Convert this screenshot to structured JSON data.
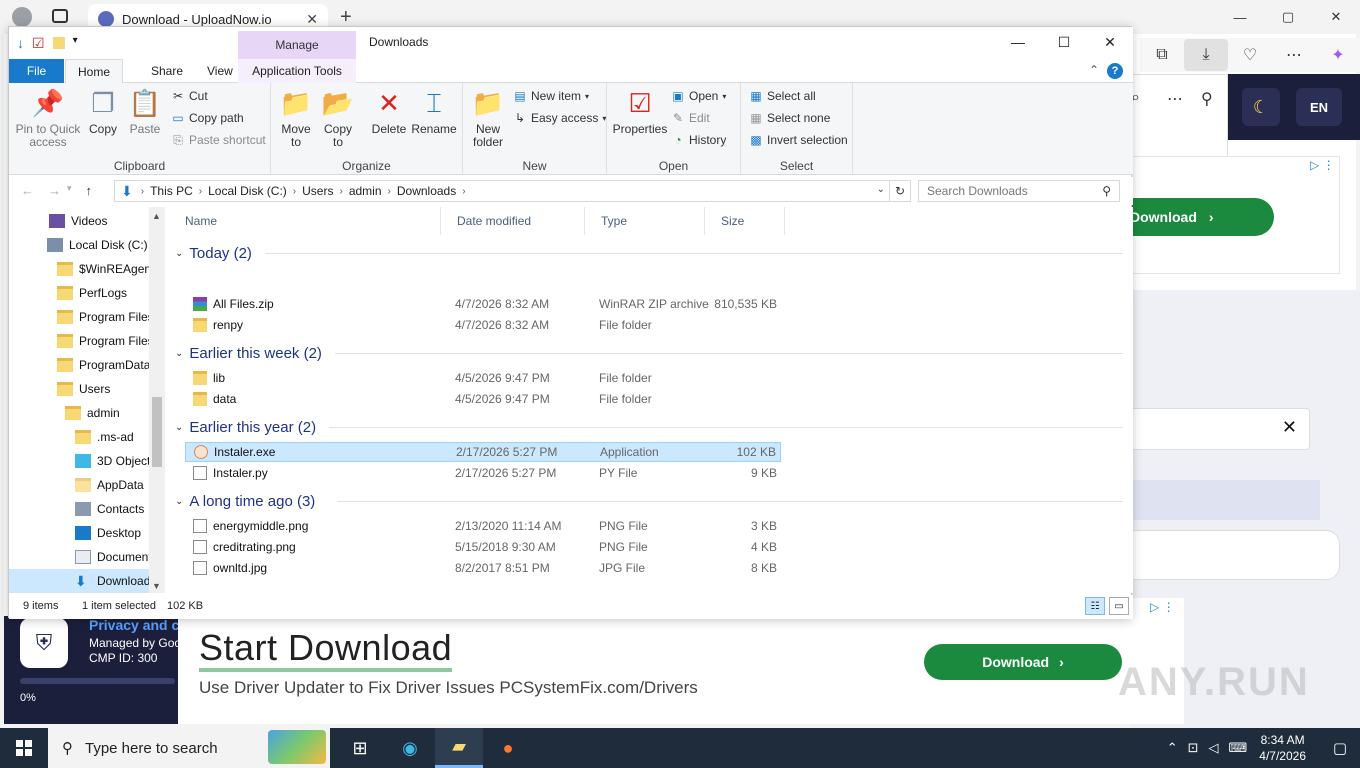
{
  "browser": {
    "tab_title": "Download - UploadNow.io",
    "tab_close": "✕",
    "new_tab": "+",
    "minimize": "—",
    "maximize": "▢",
    "close": "✕"
  },
  "site": {
    "theme_icon": "☾",
    "language": "EN",
    "right_ad_button": "Download",
    "right_ad_chevron": "›",
    "input_clear": "✕",
    "ad_choices": "▷ ⋮"
  },
  "cmp": {
    "title": "Privacy and c",
    "line1": "Managed by Goo",
    "line2": "CMP ID: 300",
    "progress_label": "0%",
    "progress_fraction": 0
  },
  "bottom_ad": {
    "title": "Start Download",
    "subtitle": "Use Driver Updater to Fix Driver Issues PCSystemFix.com/Drivers",
    "button": "Download",
    "chevron": "›",
    "ad_choices": "▷ ⋮",
    "watermark": "ANY.RUN"
  },
  "explorer": {
    "window_title": "Downloads",
    "manage_tab": "Manage",
    "minimize": "—",
    "maximize": "☐",
    "close": "✕",
    "ribbon_tabs": {
      "file": "File",
      "home": "Home",
      "share": "Share",
      "view": "View",
      "app_tools": "Application Tools"
    },
    "help": "?",
    "collapse": "⌃",
    "ribbon": {
      "clipboard": {
        "label": "Clipboard",
        "pin": "Pin to Quick access",
        "copy": "Copy",
        "paste": "Paste",
        "cut": "Cut",
        "copy_path": "Copy path",
        "paste_shortcut": "Paste shortcut"
      },
      "organize": {
        "label": "Organize",
        "move_to": "Move to",
        "copy_to": "Copy to",
        "delete": "Delete",
        "rename": "Rename"
      },
      "new": {
        "label": "New",
        "new_folder": "New folder",
        "new_item": "New item",
        "easy_access": "Easy access"
      },
      "open": {
        "label": "Open",
        "properties": "Properties",
        "open": "Open",
        "edit": "Edit",
        "history": "History"
      },
      "select": {
        "label": "Select",
        "select_all": "Select all",
        "select_none": "Select none",
        "invert": "Invert selection"
      }
    },
    "address": {
      "segments": [
        "This PC",
        "Local Disk (C:)",
        "Users",
        "admin",
        "Downloads"
      ],
      "search_placeholder": "Search Downloads"
    },
    "nav_items": [
      {
        "label": "Videos"
      },
      {
        "label": "Local Disk (C:)"
      },
      {
        "label": "$WinREAgent"
      },
      {
        "label": "PerfLogs"
      },
      {
        "label": "Program Files"
      },
      {
        "label": "Program Files"
      },
      {
        "label": "ProgramData"
      },
      {
        "label": "Users"
      },
      {
        "label": "admin"
      },
      {
        "label": ".ms-ad"
      },
      {
        "label": "3D Objects"
      },
      {
        "label": "AppData"
      },
      {
        "label": "Contacts"
      },
      {
        "label": "Desktop"
      },
      {
        "label": "Documents"
      },
      {
        "label": "Downloads"
      }
    ],
    "columns": {
      "name": "Name",
      "date": "Date modified",
      "type": "Type",
      "size": "Size"
    },
    "groups": [
      {
        "label": "Today (2)",
        "files": [
          {
            "name": "All Files.zip",
            "date": "4/7/2026 8:32 AM",
            "type": "WinRAR ZIP archive",
            "size": "810,535 KB"
          },
          {
            "name": "renpy",
            "date": "4/7/2026 8:32 AM",
            "type": "File folder",
            "size": ""
          }
        ]
      },
      {
        "label": "Earlier this week (2)",
        "files": [
          {
            "name": "lib",
            "date": "4/5/2026 9:47 PM",
            "type": "File folder",
            "size": ""
          },
          {
            "name": "data",
            "date": "4/5/2026 9:47 PM",
            "type": "File folder",
            "size": ""
          }
        ]
      },
      {
        "label": "Earlier this year (2)",
        "files": [
          {
            "name": "Instaler.exe",
            "date": "2/17/2026 5:27 PM",
            "type": "Application",
            "size": "102 KB"
          },
          {
            "name": "Instaler.py",
            "date": "2/17/2026 5:27 PM",
            "type": "PY File",
            "size": "9 KB"
          }
        ]
      },
      {
        "label": "A long time ago (3)",
        "files": [
          {
            "name": "energymiddle.png",
            "date": "2/13/2020 11:14 AM",
            "type": "PNG File",
            "size": "3 KB"
          },
          {
            "name": "creditrating.png",
            "date": "5/15/2018 9:30 AM",
            "type": "PNG File",
            "size": "4 KB"
          },
          {
            "name": "ownltd.jpg",
            "date": "8/2/2017 8:51 PM",
            "type": "JPG File",
            "size": "8 KB"
          }
        ]
      }
    ],
    "status": {
      "items": "9 items",
      "selected": "1 item selected",
      "selected_size": "102 KB"
    }
  },
  "taskbar": {
    "search_placeholder": "Type here to search",
    "time": "8:34 AM",
    "date": "4/7/2026"
  }
}
